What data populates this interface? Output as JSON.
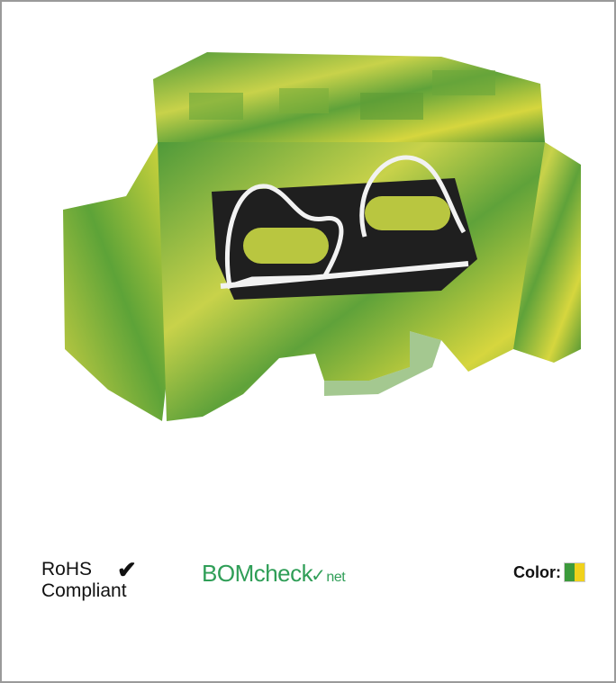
{
  "product": {
    "icon": "terminal-block-product-image",
    "colors": {
      "green": "#4f9a3a",
      "yellow": "#d9d83b",
      "clamp": "#f2f2f2",
      "dark": "#1f1f1f"
    }
  },
  "badges": {
    "rohs_line1": "RoHS",
    "rohs_check": "✔",
    "rohs_line2": "Compliant",
    "bom_main": "BOMcheck",
    "bom_tick": "✓",
    "bom_suffix": "net"
  },
  "color": {
    "label": "Color:",
    "swatch": [
      "#3c9a3c",
      "#f0d21c"
    ]
  }
}
